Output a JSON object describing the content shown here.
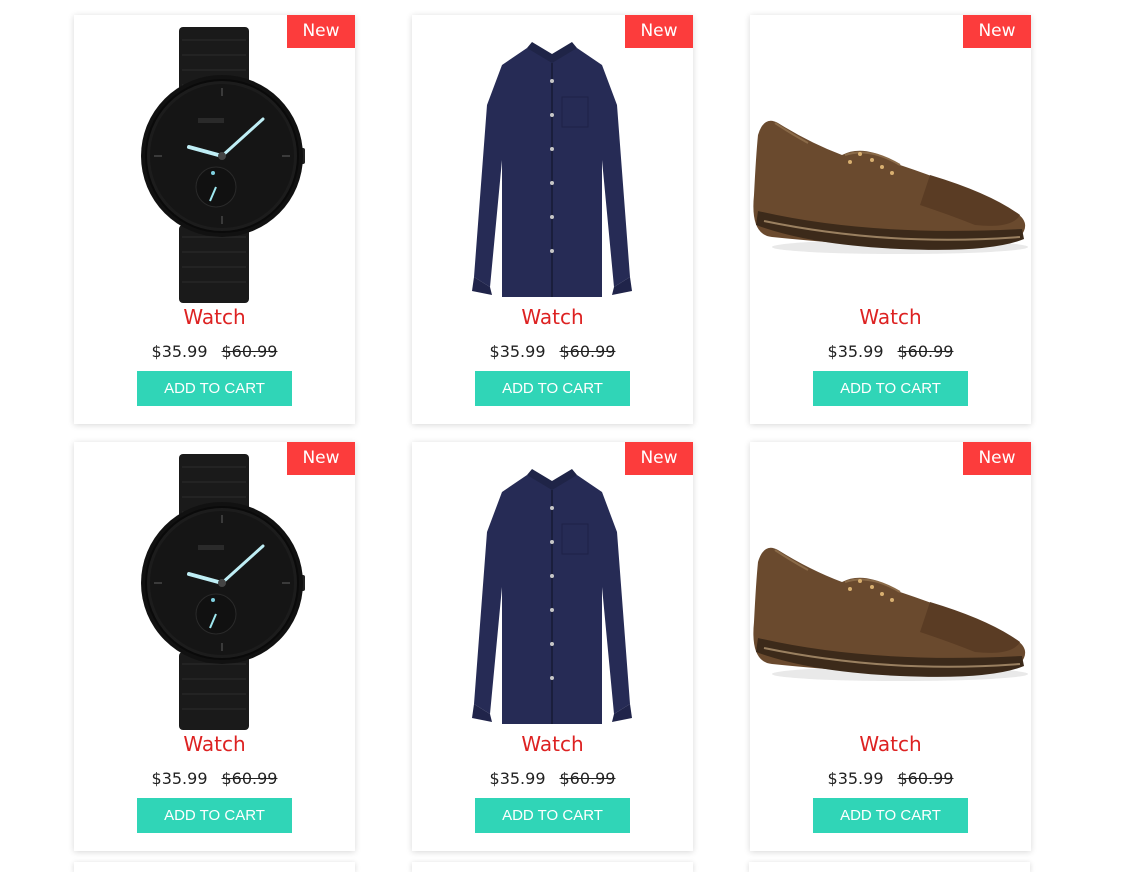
{
  "products": [
    {
      "kind": "watch",
      "icon": "watch-image",
      "badge": "New",
      "title": "Watch",
      "price": "$35.99",
      "old_price": "$60.99",
      "cta": "ADD TO CART"
    },
    {
      "kind": "shirt",
      "icon": "shirt-image",
      "badge": "New",
      "title": "Watch",
      "price": "$35.99",
      "old_price": "$60.99",
      "cta": "ADD TO CART"
    },
    {
      "kind": "shoe",
      "icon": "shoe-image",
      "badge": "New",
      "title": "Watch",
      "price": "$35.99",
      "old_price": "$60.99",
      "cta": "ADD TO CART"
    },
    {
      "kind": "watch",
      "icon": "watch-image",
      "badge": "New",
      "title": "Watch",
      "price": "$35.99",
      "old_price": "$60.99",
      "cta": "ADD TO CART"
    },
    {
      "kind": "shirt",
      "icon": "shirt-image",
      "badge": "New",
      "title": "Watch",
      "price": "$35.99",
      "old_price": "$60.99",
      "cta": "ADD TO CART"
    },
    {
      "kind": "shoe",
      "icon": "shoe-image",
      "badge": "New",
      "title": "Watch",
      "price": "$35.99",
      "old_price": "$60.99",
      "cta": "ADD TO CART"
    }
  ],
  "colors": {
    "badge": "#fc3c3c",
    "title": "#dd2222",
    "button": "#30d5b7",
    "text": "#222222"
  }
}
